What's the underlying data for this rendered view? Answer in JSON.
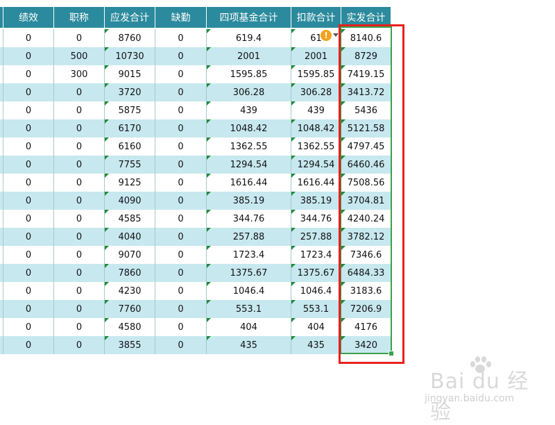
{
  "headers": [
    "",
    "绩效",
    "职称",
    "应发合计",
    "缺勤",
    "四项基金合计",
    "扣款合计",
    "实发合计"
  ],
  "rows": [
    [
      "",
      "0",
      "0",
      "8760",
      "0",
      "619.4",
      "61",
      "8140.6"
    ],
    [
      "",
      "0",
      "500",
      "10730",
      "0",
      "2001",
      "2001",
      "8729"
    ],
    [
      "",
      "0",
      "300",
      "9015",
      "0",
      "1595.85",
      "1595.85",
      "7419.15"
    ],
    [
      "",
      "0",
      "0",
      "3720",
      "0",
      "306.28",
      "306.28",
      "3413.72"
    ],
    [
      "",
      "0",
      "0",
      "5875",
      "0",
      "439",
      "439",
      "5436"
    ],
    [
      "",
      "0",
      "0",
      "6170",
      "0",
      "1048.42",
      "1048.42",
      "5121.58"
    ],
    [
      "",
      "0",
      "0",
      "6160",
      "0",
      "1362.55",
      "1362.55",
      "4797.45"
    ],
    [
      "",
      "0",
      "0",
      "7755",
      "0",
      "1294.54",
      "1294.54",
      "6460.46"
    ],
    [
      "",
      "0",
      "0",
      "9125",
      "0",
      "1616.44",
      "1616.44",
      "7508.56"
    ],
    [
      "",
      "0",
      "0",
      "4090",
      "0",
      "385.19",
      "385.19",
      "3704.81"
    ],
    [
      "",
      "0",
      "0",
      "4585",
      "0",
      "344.76",
      "344.76",
      "4240.24"
    ],
    [
      "",
      "0",
      "0",
      "4040",
      "0",
      "257.88",
      "257.88",
      "3782.12"
    ],
    [
      "",
      "0",
      "0",
      "9070",
      "0",
      "1723.4",
      "1723.4",
      "7346.6"
    ],
    [
      "",
      "0",
      "0",
      "7860",
      "0",
      "1375.67",
      "1375.67",
      "6484.33"
    ],
    [
      "",
      "0",
      "0",
      "4230",
      "0",
      "1046.4",
      "1046.4",
      "3183.6"
    ],
    [
      "",
      "0",
      "0",
      "7760",
      "0",
      "553.1",
      "553.1",
      "7206.9"
    ],
    [
      "",
      "0",
      "0",
      "4580",
      "0",
      "404",
      "404",
      "4176"
    ],
    [
      "",
      "0",
      "0",
      "3855",
      "0",
      "435",
      "435",
      "3420"
    ]
  ],
  "warning_icon_text": "!",
  "watermark": {
    "brand": "Bai du 经验",
    "url": "jingyan.baidu.com"
  },
  "colors": {
    "header_bg": "#2b8a9d",
    "row_alt_bg": "#c7e8ef",
    "selection_border": "#3aa14a",
    "highlight_box": "#e8201d"
  }
}
